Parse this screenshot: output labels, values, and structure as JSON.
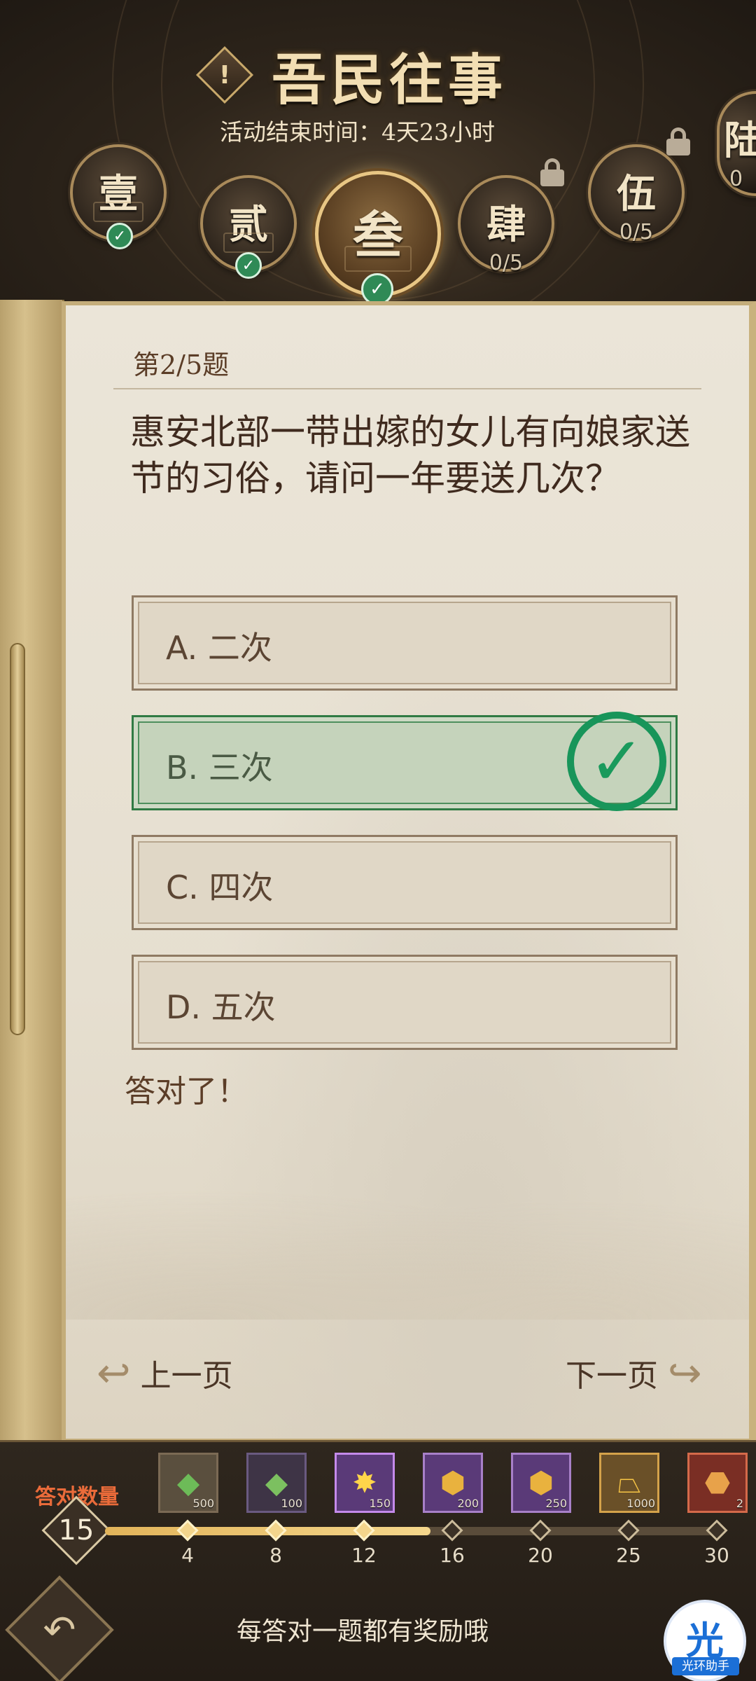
{
  "header": {
    "title": "吾民往事",
    "info_icon": "exclamation-icon",
    "end_time": "活动结束时间：4天23小时"
  },
  "chapters": [
    {
      "label": "壹",
      "state": "completed",
      "progress": ""
    },
    {
      "label": "贰",
      "state": "completed",
      "progress": ""
    },
    {
      "label": "叁",
      "state": "active-completed",
      "progress": ""
    },
    {
      "label": "肆",
      "state": "locked",
      "progress": "0/5"
    },
    {
      "label": "伍",
      "state": "locked",
      "progress": "0/5"
    },
    {
      "label": "陆",
      "state": "locked",
      "progress": "0"
    }
  ],
  "quiz": {
    "question_number": "第2/5题",
    "question": "惠安北部一带出嫁的女儿有向娘家送节的习俗，请问一年要送几次？",
    "options": [
      {
        "text": "A. 二次",
        "state": "normal"
      },
      {
        "text": "B. 三次",
        "state": "correct"
      },
      {
        "text": "C. 四次",
        "state": "normal"
      },
      {
        "text": "D. 五次",
        "state": "normal"
      }
    ],
    "result": "答对了！",
    "prev_label": "上一页",
    "next_label": "下一页"
  },
  "rewards": {
    "count_label": "答对数量",
    "count_value": "15",
    "progress_current": 15,
    "milestones": [
      "4",
      "8",
      "12",
      "16",
      "20",
      "25",
      "30"
    ],
    "items": [
      {
        "icon": "green-ore-icon",
        "amount": "500"
      },
      {
        "icon": "green-ore-icon",
        "amount": "100"
      },
      {
        "icon": "gold-burst-icon",
        "amount": "150"
      },
      {
        "icon": "gold-ore-icon",
        "amount": "200"
      },
      {
        "icon": "gold-ore-icon",
        "amount": "250"
      },
      {
        "icon": "gold-ingot-icon",
        "amount": "1000"
      },
      {
        "icon": "amber-ore-icon",
        "amount": "2"
      }
    ]
  },
  "footer": {
    "hint": "每答对一题都有奖励哦",
    "assistant_glyph": "光",
    "assistant_label": "光环助手"
  },
  "colors": {
    "accent_gold": "#e8c684",
    "correct_green": "#18955a",
    "count_label": "#ea6b3a",
    "paper": "#e6dfd0"
  }
}
